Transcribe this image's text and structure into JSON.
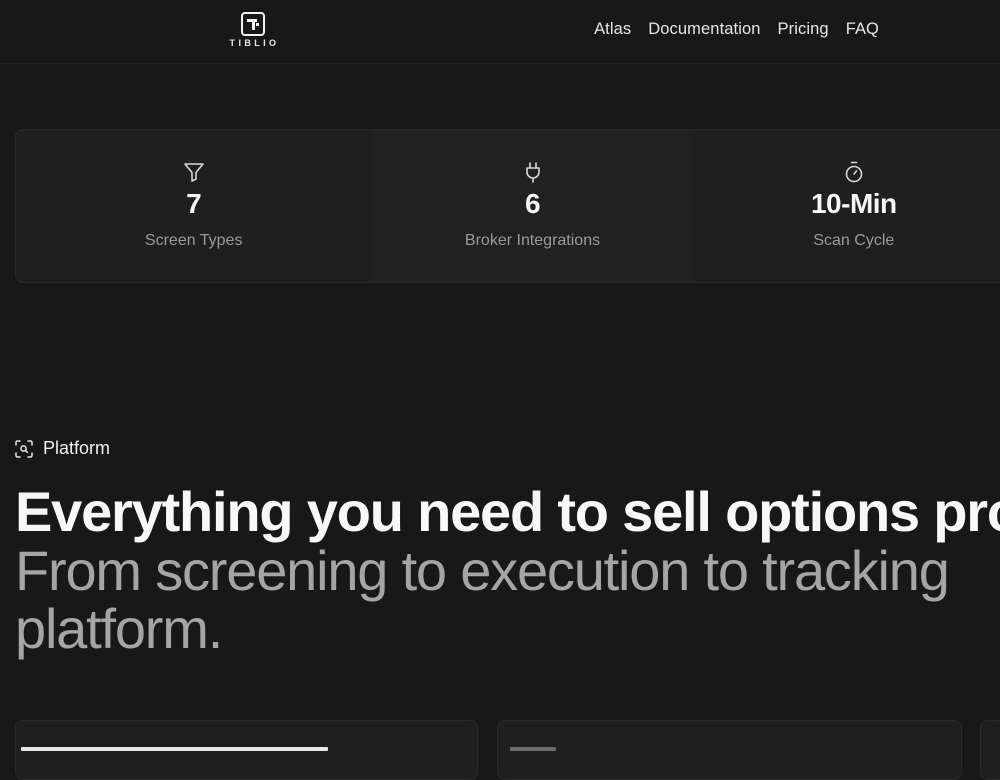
{
  "header": {
    "logo_text": "TIBLIO",
    "nav": [
      "Atlas",
      "Documentation",
      "Pricing",
      "FAQ"
    ]
  },
  "stats": [
    {
      "icon": "filter-icon",
      "value": "7",
      "label": "Screen Types"
    },
    {
      "icon": "plug-icon",
      "value": "6",
      "label": "Broker Integrations"
    },
    {
      "icon": "stopwatch-icon",
      "value": "10-Min",
      "label": "Scan Cycle"
    }
  ],
  "platform": {
    "tag": "Platform",
    "headline": "Everything you need to sell options pro",
    "subline": "From screening to execution to tracking platform."
  },
  "colors": {
    "background": "#181818",
    "panel": "#1f1f1f",
    "text_primary": "#f4f4f4",
    "text_muted": "#9a9a9a"
  }
}
